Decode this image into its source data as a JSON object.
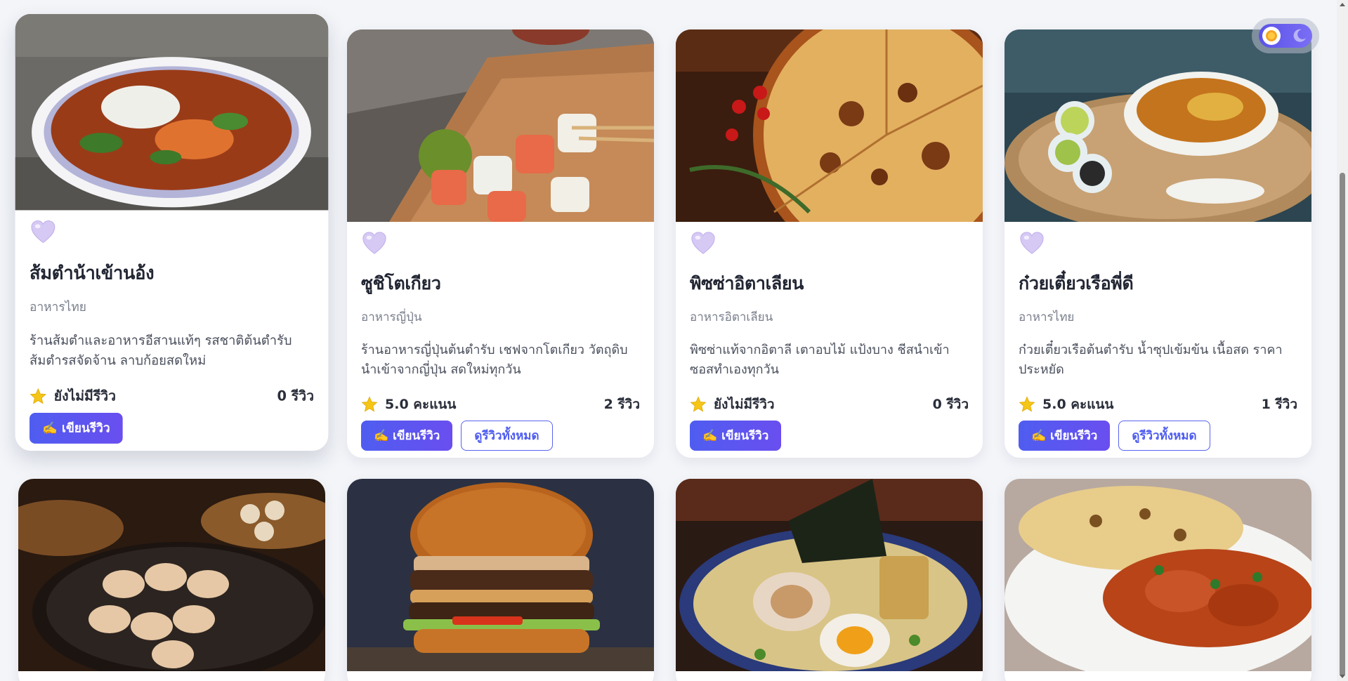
{
  "restaurants": [
    {
      "name": "ส้มตำน้าเข้านอ้ง",
      "cuisine": "อาหารไทย",
      "description": "ร้านส้มตำและอาหารอีสานแท้ๆ รสชาติต้นตำรับ ส้มตำรสจัดจ้าน ลาบก้อยสดใหม่",
      "rating_text": "ยังไม่มีรีวิว",
      "review_count": "0 รีวิว",
      "write_label": "✍️ เขียนรีวิว",
      "view_all_label": ""
    },
    {
      "name": "ซูชิโตเกียว",
      "cuisine": "อาหารญี่ปุ่น",
      "description": "ร้านอาหารญี่ปุ่นต้นตำรับ เชฟจากโตเกียว วัตถุดิบนำเข้าจากญี่ปุ่น สดใหม่ทุกวัน",
      "rating_text": "5.0 คะแนน",
      "review_count": "2 รีวิว",
      "write_label": "✍️ เขียนรีวิว",
      "view_all_label": "ดูรีวิวทั้งหมด"
    },
    {
      "name": "พิซซ่าอิตาเลียน",
      "cuisine": "อาหารอิตาเลียน",
      "description": "พิซซ่าแท้จากอิตาลี เตาอบไม้ แป้งบาง ชีสนำเข้า ซอสทำเองทุกวัน",
      "rating_text": "ยังไม่มีรีวิว",
      "review_count": "0 รีวิว",
      "write_label": "✍️ เขียนรีวิว",
      "view_all_label": ""
    },
    {
      "name": "ก๋วยเตี๋ยวเรือพี่ดี",
      "cuisine": "อาหารไทย",
      "description": "ก๋วยเตี๋ยวเรือต้นตำรับ น้ำซุปเข้มข้น เนื้อสด ราคาประหยัด",
      "rating_text": "5.0 คะแนน",
      "review_count": "1 รีวิว",
      "write_label": "✍️ เขียนรีวิว",
      "view_all_label": "ดูรีวิวทั้งหมด"
    }
  ],
  "second_row_images": [
    "dumplings-photo",
    "burger-photo",
    "ramen-photo",
    "curry-naan-photo"
  ],
  "theme_toggle": {
    "light_icon": "sun-icon",
    "dark_icon": "moon-icon"
  },
  "colors": {
    "accent": "#5a5cf0",
    "star": "#f5c518",
    "heart": "#c9b8f2"
  }
}
